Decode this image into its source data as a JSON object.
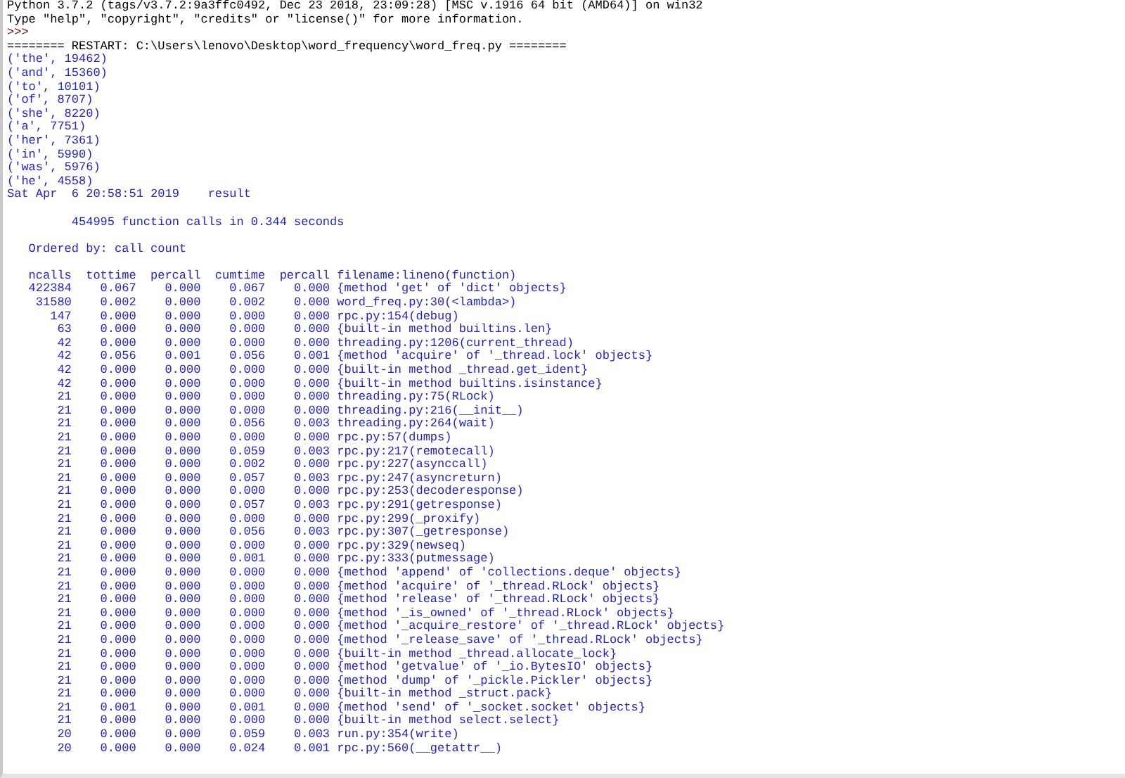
{
  "shell": {
    "banner": [
      "Python 3.7.2 (tags/v3.7.2:9a3ffc0492, Dec 23 2018, 23:09:28) [MSC v.1916 64 bit (AMD64)] on win32",
      "Type \"help\", \"copyright\", \"credits\" or \"license()\" for more information."
    ],
    "prompt": ">>>",
    "restart": "======== RESTART: C:\\Users\\lenovo\\Desktop\\word_frequency\\word_freq.py ========",
    "output": [
      "('the', 19462)",
      "('and', 15360)",
      "('to', 10101)",
      "('of', 8707)",
      "('she', 8220)",
      "('a', 7751)",
      "('her', 7361)",
      "('in', 5990)",
      "('was', 5976)",
      "('he', 4558)"
    ],
    "timestamp": "Sat Apr  6 20:58:51 2019    result",
    "summary": "454995 function calls in 0.344 seconds",
    "order": "Ordered by: call count",
    "columns": [
      "ncalls",
      "tottime",
      "percall",
      "cumtime",
      "percall",
      "filename:lineno(function)"
    ],
    "rows": [
      {
        "cells": [
          "422384",
          "0.067",
          "0.000",
          "0.067",
          "0.000",
          "{method 'get' of 'dict' objects}"
        ]
      },
      {
        "cells": [
          "31580",
          "0.002",
          "0.000",
          "0.002",
          "0.000",
          "word_freq.py:30(<lambda>)"
        ]
      },
      {
        "cells": [
          "147",
          "0.000",
          "0.000",
          "0.000",
          "0.000",
          "rpc.py:154(debug)"
        ]
      },
      {
        "cells": [
          "63",
          "0.000",
          "0.000",
          "0.000",
          "0.000",
          "{built-in method builtins.len}"
        ]
      },
      {
        "cells": [
          "42",
          "0.000",
          "0.000",
          "0.000",
          "0.000",
          "threading.py:1206(current_thread)"
        ]
      },
      {
        "cells": [
          "42",
          "0.056",
          "0.001",
          "0.056",
          "0.001",
          "{method 'acquire' of '_thread.lock' objects}"
        ]
      },
      {
        "cells": [
          "42",
          "0.000",
          "0.000",
          "0.000",
          "0.000",
          "{built-in method _thread.get_ident}"
        ]
      },
      {
        "cells": [
          "42",
          "0.000",
          "0.000",
          "0.000",
          "0.000",
          "{built-in method builtins.isinstance}"
        ]
      },
      {
        "cells": [
          "21",
          "0.000",
          "0.000",
          "0.000",
          "0.000",
          "threading.py:75(RLock)"
        ]
      },
      {
        "cells": [
          "21",
          "0.000",
          "0.000",
          "0.000",
          "0.000",
          "threading.py:216(__init__)"
        ]
      },
      {
        "cells": [
          "21",
          "0.000",
          "0.000",
          "0.056",
          "0.003",
          "threading.py:264(wait)"
        ]
      },
      {
        "cells": [
          "21",
          "0.000",
          "0.000",
          "0.000",
          "0.000",
          "rpc.py:57(dumps)"
        ]
      },
      {
        "cells": [
          "21",
          "0.000",
          "0.000",
          "0.059",
          "0.003",
          "rpc.py:217(remotecall)"
        ]
      },
      {
        "cells": [
          "21",
          "0.000",
          "0.000",
          "0.002",
          "0.000",
          "rpc.py:227(asynccall)"
        ]
      },
      {
        "cells": [
          "21",
          "0.000",
          "0.000",
          "0.057",
          "0.003",
          "rpc.py:247(asyncreturn)"
        ]
      },
      {
        "cells": [
          "21",
          "0.000",
          "0.000",
          "0.000",
          "0.000",
          "rpc.py:253(decoderesponse)"
        ]
      },
      {
        "cells": [
          "21",
          "0.000",
          "0.000",
          "0.057",
          "0.003",
          "rpc.py:291(getresponse)"
        ]
      },
      {
        "cells": [
          "21",
          "0.000",
          "0.000",
          "0.000",
          "0.000",
          "rpc.py:299(_proxify)"
        ]
      },
      {
        "cells": [
          "21",
          "0.000",
          "0.000",
          "0.056",
          "0.003",
          "rpc.py:307(_getresponse)"
        ]
      },
      {
        "cells": [
          "21",
          "0.000",
          "0.000",
          "0.000",
          "0.000",
          "rpc.py:329(newseq)"
        ]
      },
      {
        "cells": [
          "21",
          "0.000",
          "0.000",
          "0.001",
          "0.000",
          "rpc.py:333(putmessage)"
        ]
      },
      {
        "cells": [
          "21",
          "0.000",
          "0.000",
          "0.000",
          "0.000",
          "{method 'append' of 'collections.deque' objects}"
        ]
      },
      {
        "cells": [
          "21",
          "0.000",
          "0.000",
          "0.000",
          "0.000",
          "{method 'acquire' of '_thread.RLock' objects}"
        ]
      },
      {
        "cells": [
          "21",
          "0.000",
          "0.000",
          "0.000",
          "0.000",
          "{method 'release' of '_thread.RLock' objects}"
        ]
      },
      {
        "cells": [
          "21",
          "0.000",
          "0.000",
          "0.000",
          "0.000",
          "{method '_is_owned' of '_thread.RLock' objects}"
        ]
      },
      {
        "cells": [
          "21",
          "0.000",
          "0.000",
          "0.000",
          "0.000",
          "{method '_acquire_restore' of '_thread.RLock' objects}"
        ]
      },
      {
        "cells": [
          "21",
          "0.000",
          "0.000",
          "0.000",
          "0.000",
          "{method '_release_save' of '_thread.RLock' objects}"
        ]
      },
      {
        "cells": [
          "21",
          "0.000",
          "0.000",
          "0.000",
          "0.000",
          "{built-in method _thread.allocate_lock}"
        ]
      },
      {
        "cells": [
          "21",
          "0.000",
          "0.000",
          "0.000",
          "0.000",
          "{method 'getvalue' of '_io.BytesIO' objects}"
        ]
      },
      {
        "cells": [
          "21",
          "0.000",
          "0.000",
          "0.000",
          "0.000",
          "{method 'dump' of '_pickle.Pickler' objects}"
        ]
      },
      {
        "cells": [
          "21",
          "0.000",
          "0.000",
          "0.000",
          "0.000",
          "{built-in method _struct.pack}"
        ]
      },
      {
        "cells": [
          "21",
          "0.001",
          "0.000",
          "0.001",
          "0.000",
          "{method 'send' of '_socket.socket' objects}"
        ]
      },
      {
        "cells": [
          "21",
          "0.000",
          "0.000",
          "0.000",
          "0.000",
          "{built-in method select.select}"
        ]
      },
      {
        "cells": [
          "20",
          "0.000",
          "0.000",
          "0.059",
          "0.003",
          "run.py:354(write)"
        ]
      },
      {
        "cells": [
          "20",
          "0.000",
          "0.000",
          "0.024",
          "0.001",
          "rpc.py:560(__getattr__)"
        ]
      }
    ]
  }
}
